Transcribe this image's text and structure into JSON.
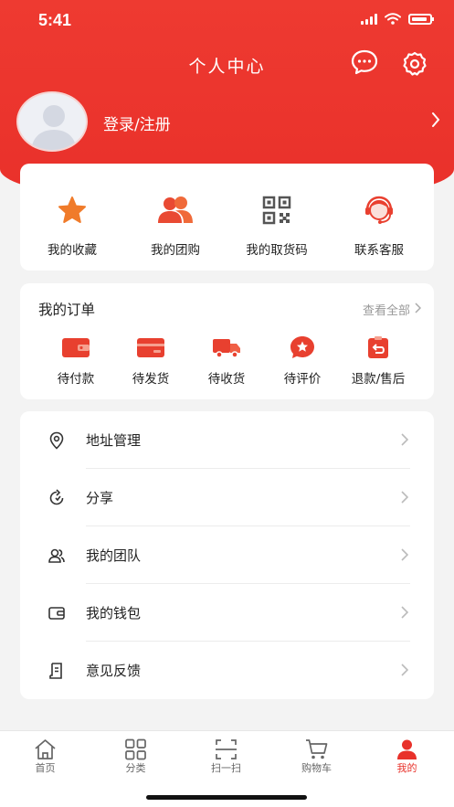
{
  "status_bar": {
    "time": "5:41"
  },
  "header": {
    "title": "个人中心",
    "message_icon": "message-bubble-icon",
    "settings_icon": "gear-icon"
  },
  "profile": {
    "login_label": "登录/注册"
  },
  "quick_actions": [
    {
      "label": "我的收藏",
      "icon": "star-icon"
    },
    {
      "label": "我的团购",
      "icon": "group-users-icon"
    },
    {
      "label": "我的取货码",
      "icon": "qr-code-icon"
    },
    {
      "label": "联系客服",
      "icon": "customer-service-icon"
    }
  ],
  "orders": {
    "title": "我的订单",
    "view_all": "查看全部",
    "items": [
      {
        "label": "待付款",
        "icon": "wallet-icon"
      },
      {
        "label": "待发货",
        "icon": "package-icon"
      },
      {
        "label": "待收货",
        "icon": "truck-icon"
      },
      {
        "label": "待评价",
        "icon": "review-star-icon"
      },
      {
        "label": "退款/售后",
        "icon": "refund-icon"
      }
    ]
  },
  "menu": [
    {
      "label": "地址管理",
      "icon": "location-icon"
    },
    {
      "label": "分享",
      "icon": "share-icon"
    },
    {
      "label": "我的团队",
      "icon": "team-icon"
    },
    {
      "label": "我的钱包",
      "icon": "wallet-outline-icon"
    },
    {
      "label": "意见反馈",
      "icon": "feedback-icon"
    }
  ],
  "tab_bar": [
    {
      "label": "首页",
      "icon": "home-icon",
      "active": false
    },
    {
      "label": "分类",
      "icon": "category-icon",
      "active": false
    },
    {
      "label": "扫一扫",
      "icon": "scan-icon",
      "active": false
    },
    {
      "label": "购物车",
      "icon": "cart-icon",
      "active": false
    },
    {
      "label": "我的",
      "icon": "user-icon",
      "active": true
    }
  ],
  "colors": {
    "brand_red": "#e8312a",
    "background": "#f3f3f3"
  }
}
